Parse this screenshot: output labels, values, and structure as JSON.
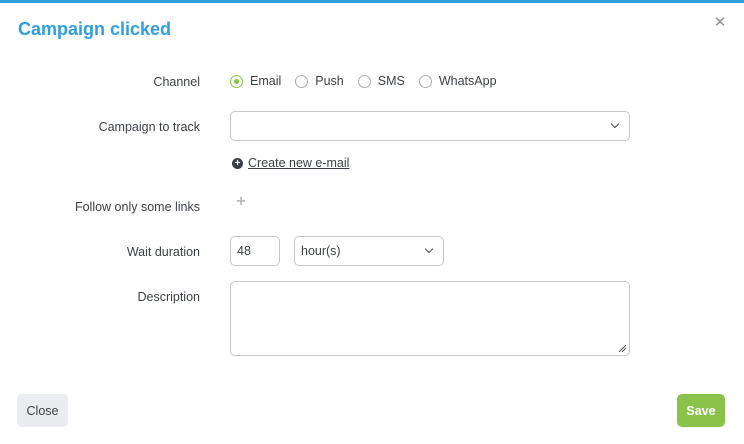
{
  "dialog": {
    "title": "Campaign clicked",
    "close_icon": "close-icon"
  },
  "form": {
    "channel": {
      "label": "Channel",
      "options": [
        "Email",
        "Push",
        "SMS",
        "WhatsApp"
      ],
      "selected": "Email"
    },
    "campaign": {
      "label": "Campaign to track",
      "value": "",
      "create_link": "Create new e-mail"
    },
    "links": {
      "label": "Follow only some links",
      "add_icon": "plus-icon"
    },
    "wait": {
      "label": "Wait duration",
      "value": "48",
      "unit": "hour(s)"
    },
    "description": {
      "label": "Description",
      "value": ""
    }
  },
  "footer": {
    "close_label": "Close",
    "save_label": "Save"
  },
  "colors": {
    "accent": "#2f9fe0",
    "save": "#8bc34a"
  }
}
